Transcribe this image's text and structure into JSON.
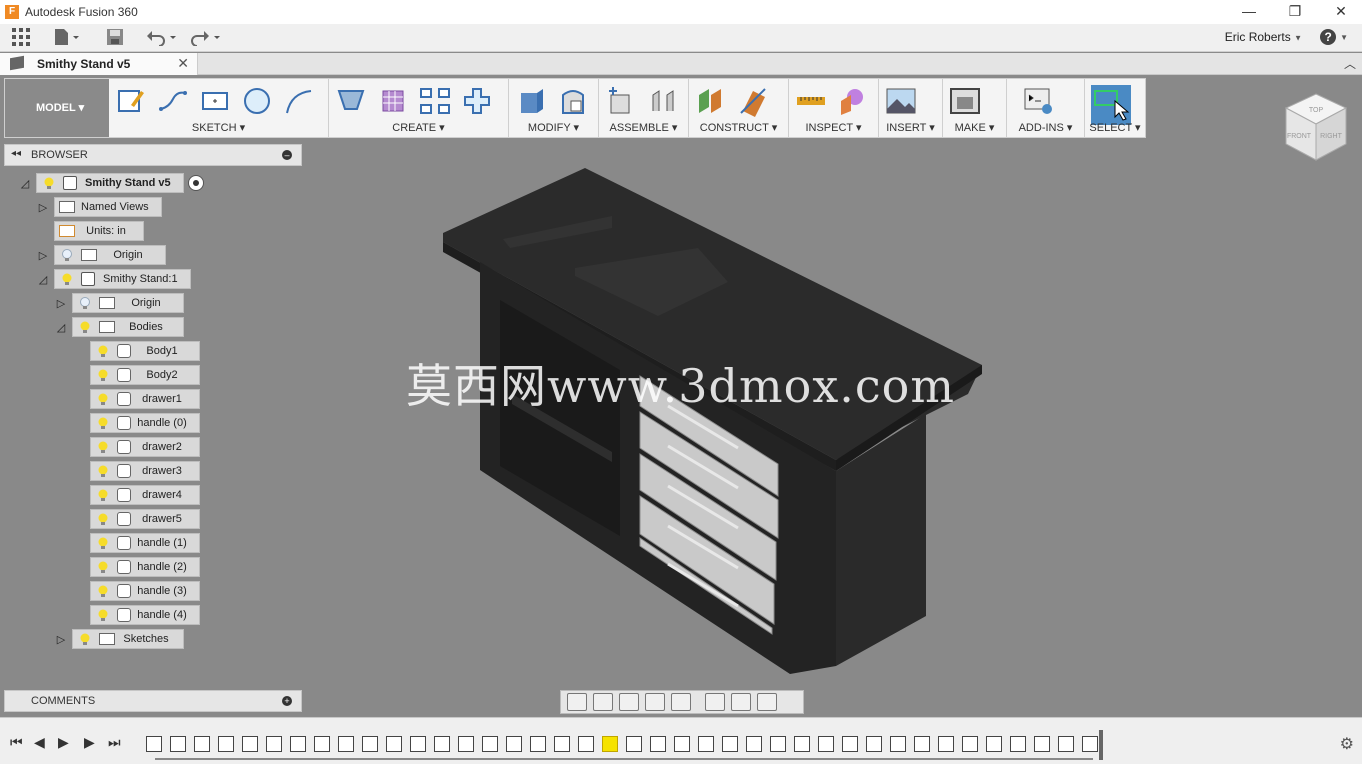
{
  "app": {
    "title": "Autodesk Fusion 360",
    "logo_letter": "F"
  },
  "window_controls": {
    "minimize": "—",
    "restore": "❐",
    "close": "✕"
  },
  "user": {
    "name": "Eric Roberts",
    "help": "?"
  },
  "document_tab": {
    "label": "Smithy Stand v5",
    "close": "✕"
  },
  "toolbar": {
    "workspace": "MODEL ▾",
    "groups": [
      {
        "label": "SKETCH ▾"
      },
      {
        "label": "CREATE ▾"
      },
      {
        "label": "MODIFY ▾"
      },
      {
        "label": "ASSEMBLE ▾"
      },
      {
        "label": "CONSTRUCT ▾"
      },
      {
        "label": "INSPECT ▾"
      },
      {
        "label": "INSERT ▾"
      },
      {
        "label": "MAKE ▾"
      },
      {
        "label": "ADD-INS ▾"
      },
      {
        "label": "SELECT ▾"
      }
    ]
  },
  "browser": {
    "title": "BROWSER",
    "tree": {
      "root": "Smithy Stand v5",
      "named_views": "Named Views",
      "units": "Units: in",
      "origin": "Origin",
      "component": "Smithy Stand:1",
      "comp_origin": "Origin",
      "bodies": "Bodies",
      "body_items": [
        "Body1",
        "Body2",
        "drawer1",
        "handle (0)",
        "drawer2",
        "drawer3",
        "drawer4",
        "drawer5",
        "handle (1)",
        "handle (2)",
        "handle (3)",
        "handle (4)"
      ],
      "sketches": "Sketches"
    }
  },
  "comments": {
    "title": "COMMENTS"
  },
  "viewcube": {
    "top": "TOP",
    "front": "FRONT",
    "right": "RIGHT"
  },
  "watermark": "莫西网www.3dmox.com",
  "colors": {
    "accent": "#4a8ac4",
    "viewport": "#898989",
    "panel": "#f4f4f4"
  }
}
